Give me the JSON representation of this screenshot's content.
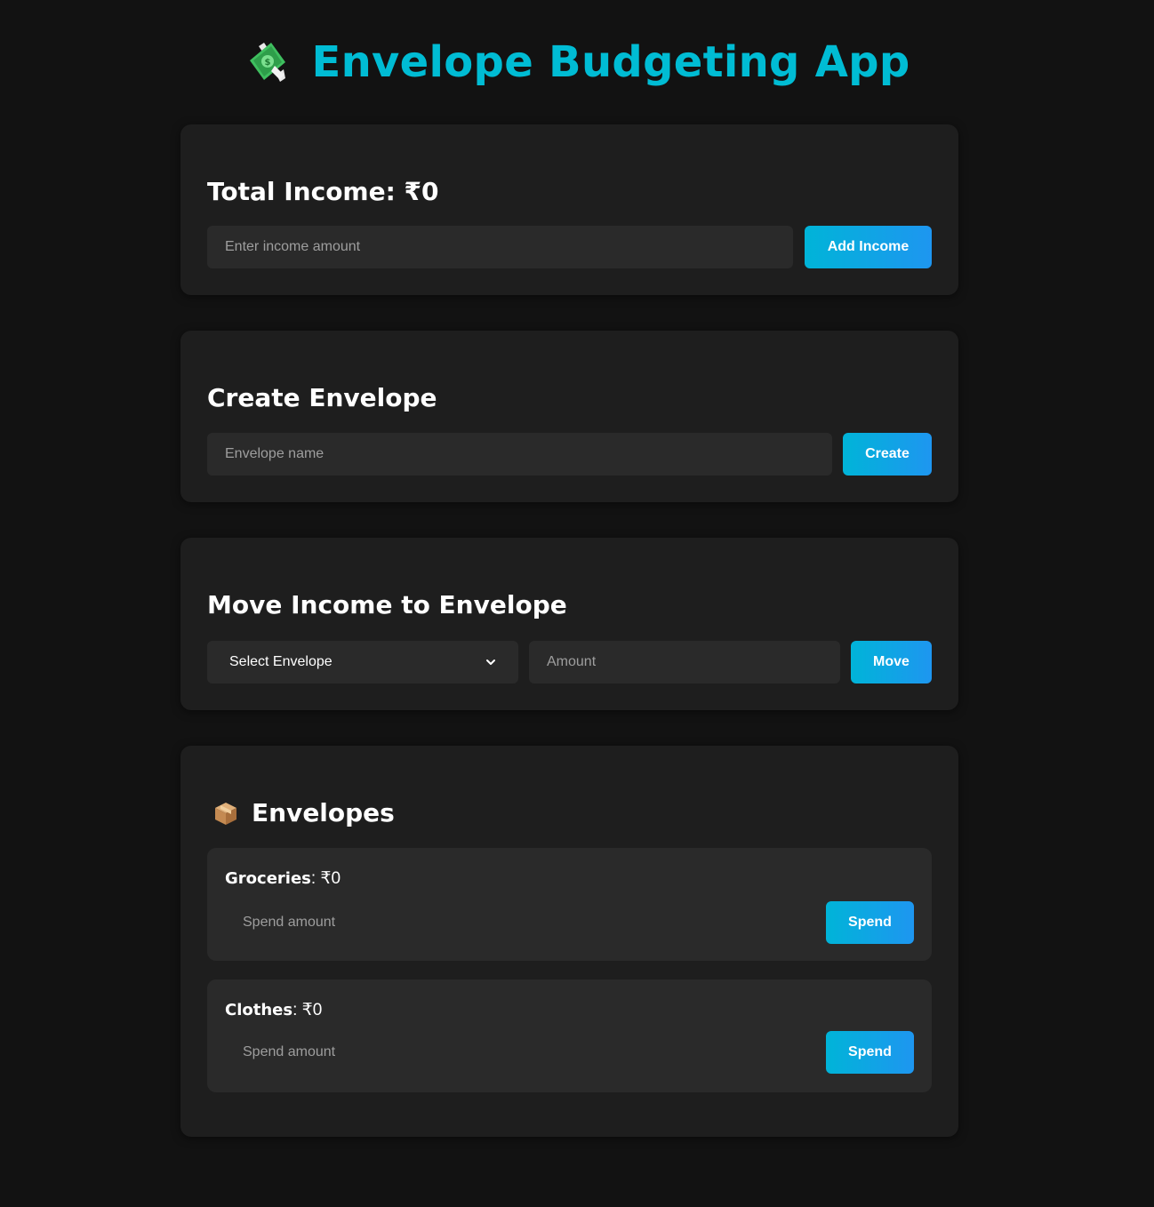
{
  "header": {
    "icon": "money-with-wings-icon",
    "title": "Envelope Budgeting App"
  },
  "income": {
    "title": "Total Income: ₹0",
    "input_placeholder": "Enter income amount",
    "button_label": "Add Income"
  },
  "create_envelope": {
    "title": "Create Envelope",
    "input_placeholder": "Envelope name",
    "button_label": "Create"
  },
  "move_income": {
    "title": "Move Income to Envelope",
    "select_value": "Select Envelope",
    "amount_placeholder": "Amount",
    "button_label": "Move"
  },
  "envelopes": {
    "icon": "package-box-icon",
    "title": "Envelopes",
    "items": [
      {
        "name": "Groceries",
        "amount": ": ₹0",
        "spend_placeholder": "Spend amount",
        "button_label": "Spend"
      },
      {
        "name": "Clothes",
        "amount": ": ₹0",
        "spend_placeholder": "Spend amount",
        "button_label": "Spend"
      }
    ]
  },
  "colors": {
    "background": "#121212",
    "card": "#1e1e1e",
    "field": "#2a2a2a",
    "accent": "#00bcd4",
    "button_gradient_start": "#00b4d8",
    "button_gradient_end": "#1e96f0"
  }
}
